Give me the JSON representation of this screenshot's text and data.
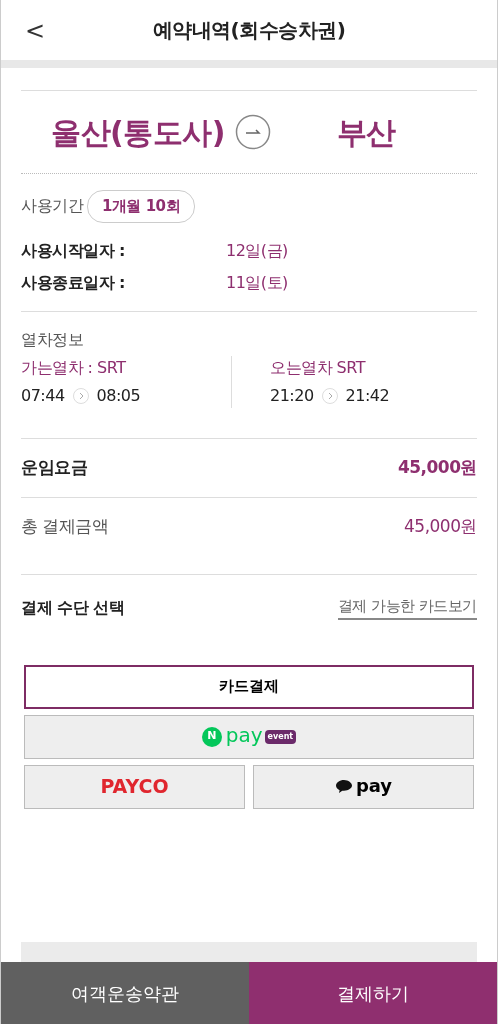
{
  "header": {
    "back": "<",
    "title": "예약내역(회수승차권)"
  },
  "route": {
    "from": "울산(통도사)",
    "to": "부산"
  },
  "period": {
    "label": "사용기간",
    "value": "1개월 10회"
  },
  "dates": [
    {
      "label": "사용시작일자 :",
      "value": "12일(금)"
    },
    {
      "label": "사용종료일자 :",
      "value": "11일(토)"
    }
  ],
  "trains": {
    "title": "열차정보",
    "legs": [
      {
        "label": "가는열차 : SRT",
        "depart": "07:44",
        "arrive": "08:05"
      },
      {
        "label": "오는열차 SRT",
        "depart": "21:20",
        "arrive": "21:42"
      }
    ]
  },
  "fare": {
    "label": "운임요금",
    "amount": "45,000원"
  },
  "total": {
    "label": "총 결제금액",
    "amount": "45,000원"
  },
  "payment": {
    "title": "결제 수단 선택",
    "link": "결제 가능한 카드보기",
    "methods": [
      {
        "kind": "card",
        "label": "카드결제",
        "selected": true
      },
      {
        "kind": "npay",
        "badge": "N",
        "label": "pay",
        "tag": "event",
        "selected": false
      },
      {
        "kind": "payco",
        "label": "PAYCO",
        "selected": false
      },
      {
        "kind": "kakaopay",
        "label": "pay",
        "selected": false
      }
    ]
  },
  "footer": [
    {
      "label": "여객운송약관",
      "kind": "secondary"
    },
    {
      "label": "결제하기",
      "kind": "primary"
    }
  ]
}
